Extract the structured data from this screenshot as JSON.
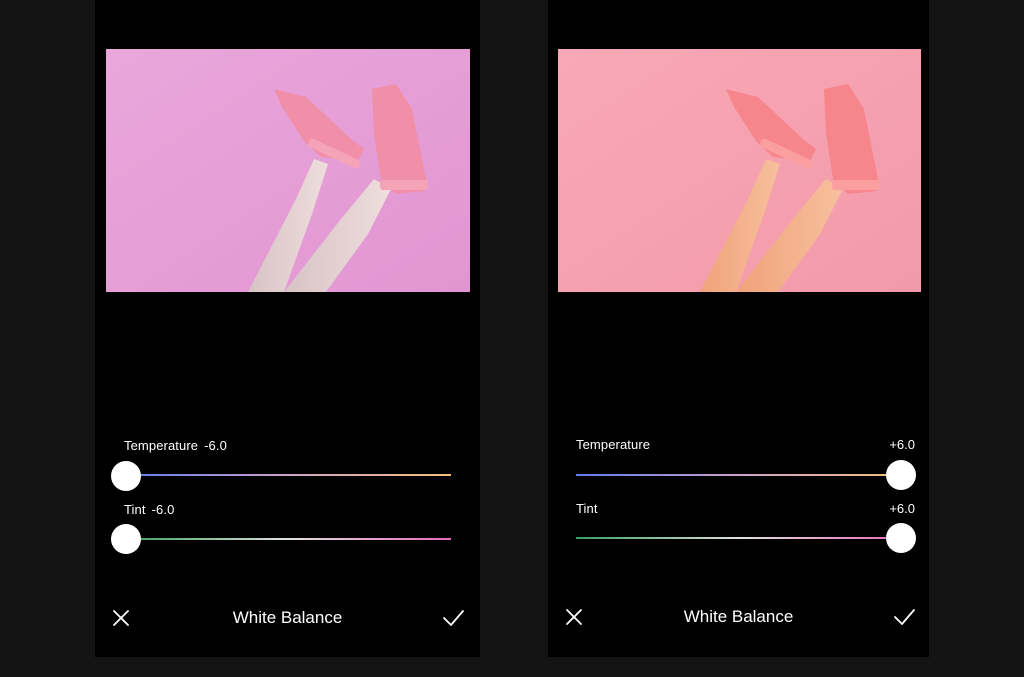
{
  "panels": [
    {
      "temperature": {
        "label": "Temperature",
        "value": "-6.0"
      },
      "tint": {
        "label": "Tint",
        "value": "-6.0"
      },
      "title": "White Balance",
      "cancel_icon": "close-icon",
      "confirm_icon": "check-icon",
      "photo_tone": "#e7a0d6"
    },
    {
      "temperature": {
        "label": "Temperature",
        "value": "+6.0"
      },
      "tint": {
        "label": "Tint",
        "value": "+6.0"
      },
      "title": "White Balance",
      "cancel_icon": "close-icon",
      "confirm_icon": "check-icon",
      "photo_tone": "#f6a3b1"
    }
  ],
  "colors": {
    "background": "#141414",
    "panel": "#000000",
    "temperature_track": [
      "#5b7cf0",
      "#f2c078"
    ],
    "tint_track": [
      "#3aa05a",
      "#e668b8"
    ]
  }
}
